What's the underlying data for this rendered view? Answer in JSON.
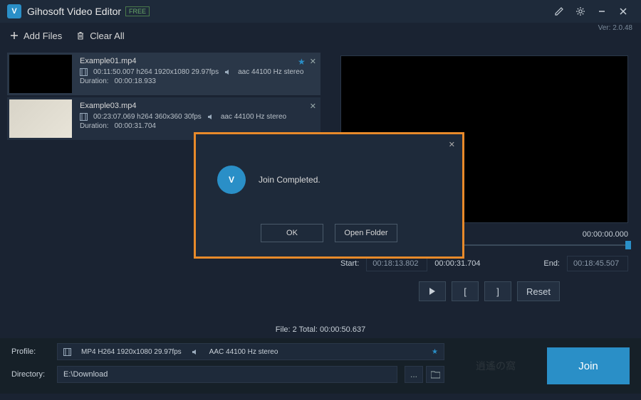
{
  "app": {
    "title": "Gihosoft Video Editor",
    "badge": "FREE",
    "version": "Ver: 2.0.48"
  },
  "toolbar": {
    "add_files": "Add Files",
    "clear_all": "Clear All"
  },
  "files": [
    {
      "name": "Example01.mp4",
      "video": "00:11:50.007 h264 1920x1080 29.97fps",
      "audio": "aac 44100 Hz stereo",
      "duration_label": "Duration:",
      "duration": "00:00:18.933",
      "starred": true
    },
    {
      "name": "Example03.mp4",
      "video": "00:23:07.069 h264 360x360 30fps",
      "audio": "aac 44100 Hz stereo",
      "duration_label": "Duration:",
      "duration": "00:00:31.704",
      "starred": false
    }
  ],
  "preview": {
    "time_display": "00:00:00.000",
    "start_label": "Start:",
    "start_value": "00:18:13.802",
    "mid_value": "00:00:31.704",
    "end_label": "End:",
    "end_value": "00:18:45.507",
    "reset": "Reset"
  },
  "status": {
    "text": "File: 2   Total: 00:00:50.637"
  },
  "bottom": {
    "profile_label": "Profile:",
    "profile_video": "MP4 H264 1920x1080 29.97fps",
    "profile_audio": "AAC 44100 Hz stereo",
    "directory_label": "Directory:",
    "directory_value": "E:\\Download",
    "browse": "...",
    "join": "Join"
  },
  "modal": {
    "message": "Join Completed.",
    "ok": "OK",
    "open_folder": "Open Folder"
  }
}
